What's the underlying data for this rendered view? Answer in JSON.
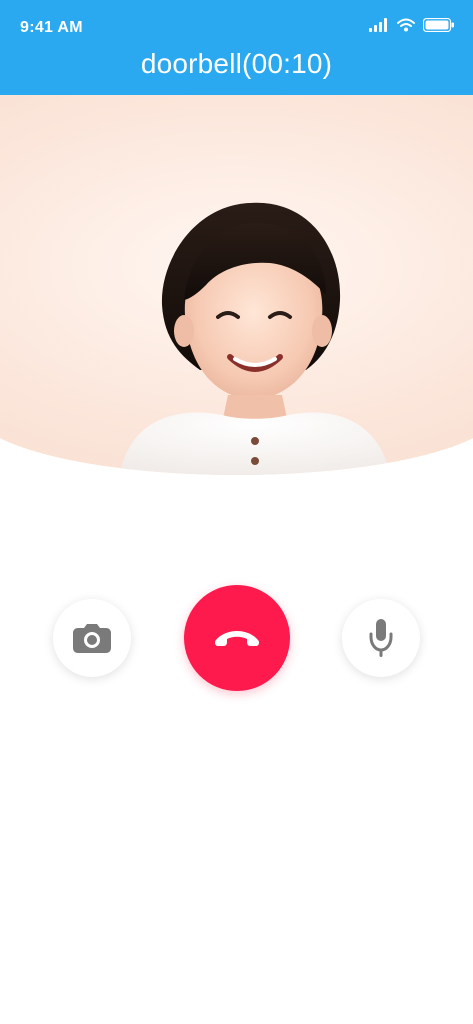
{
  "status_bar": {
    "time": "9:41 AM",
    "icons": [
      "cellular-signal-icon",
      "wifi-icon",
      "battery-icon"
    ]
  },
  "header": {
    "title": "doorbell",
    "duration": "(00:10)"
  },
  "video": {
    "content": "doorbell-camera-feed"
  },
  "controls": {
    "camera_icon": "camera-icon",
    "hangup_icon": "phone-hangup-icon",
    "mic_icon": "microphone-icon"
  },
  "colors": {
    "header": "#2aa8f0",
    "hangup": "#ff1a4d",
    "icon_gray": "#7a7a7a",
    "white": "#ffffff"
  }
}
